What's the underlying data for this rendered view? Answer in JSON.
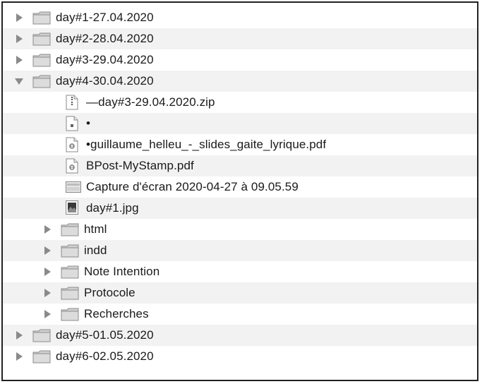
{
  "rows": [
    {
      "label": "day#1-27.04.2020",
      "icon": "folder-icon",
      "expanded": false,
      "level": 0
    },
    {
      "label": "day#2-28.04.2020",
      "icon": "folder-icon",
      "expanded": false,
      "level": 0
    },
    {
      "label": "day#3-29.04.2020",
      "icon": "folder-icon",
      "expanded": false,
      "level": 0
    },
    {
      "label": "day#4-30.04.2020",
      "icon": "folder-icon",
      "expanded": true,
      "level": 0
    },
    {
      "label": "—day#3-29.04.2020.zip",
      "icon": "zip-file-icon",
      "level": 1
    },
    {
      "label": "•",
      "icon": "document-icon",
      "level": 1
    },
    {
      "label": "•guillaume_helleu_-_slides_gaite_lyrique.pdf",
      "icon": "pdf-file-icon",
      "level": 1
    },
    {
      "label": "BPost-MyStamp.pdf",
      "icon": "pdf-file-icon",
      "level": 1
    },
    {
      "label": "Capture d'écran 2020-04-27 à 09.05.59",
      "icon": "screenshot-file-icon",
      "level": 1
    },
    {
      "label": "day#1.jpg",
      "icon": "image-file-icon",
      "level": 1
    },
    {
      "label": "html",
      "icon": "folder-icon",
      "expanded": false,
      "level": 1
    },
    {
      "label": "indd",
      "icon": "folder-icon",
      "expanded": false,
      "level": 1
    },
    {
      "label": "Note Intention",
      "icon": "folder-icon",
      "expanded": false,
      "level": 1
    },
    {
      "label": "Protocole",
      "icon": "folder-icon",
      "expanded": false,
      "level": 1
    },
    {
      "label": "Recherches",
      "icon": "folder-icon",
      "expanded": false,
      "level": 1
    },
    {
      "label": "day#5-01.05.2020",
      "icon": "folder-icon",
      "expanded": false,
      "level": 0
    },
    {
      "label": "day#6-02.05.2020",
      "icon": "folder-icon",
      "expanded": false,
      "level": 0
    }
  ]
}
